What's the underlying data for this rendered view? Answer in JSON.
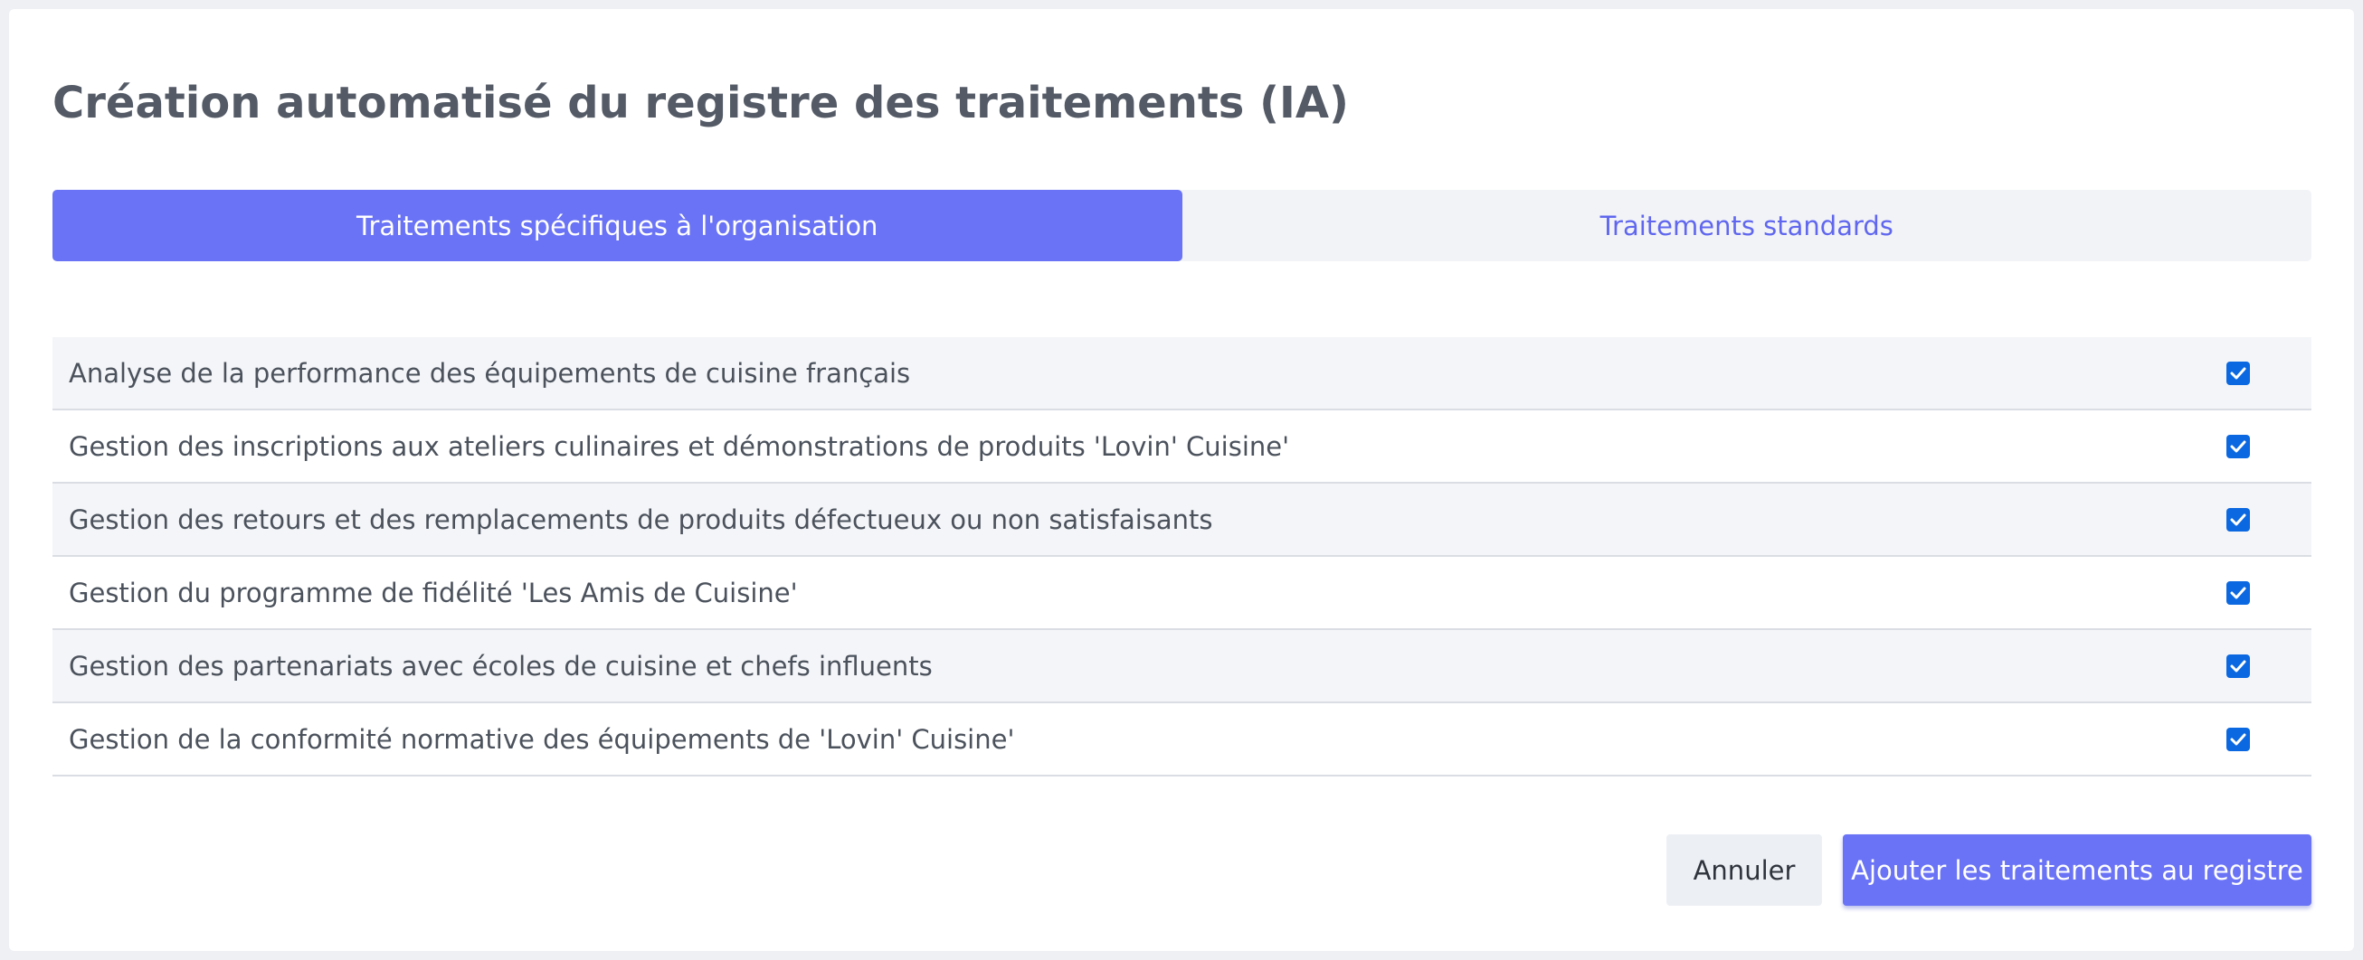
{
  "modal": {
    "title": "Création automatisé du registre des traitements (IA)"
  },
  "tabs": [
    {
      "label": "Traitements spécifiques à l'organisation",
      "active": true
    },
    {
      "label": "Traitements standards",
      "active": false
    }
  ],
  "treatments": [
    {
      "label": "Analyse de la performance des équipements de cuisine français",
      "checked": true
    },
    {
      "label": "Gestion des inscriptions aux ateliers culinaires et démonstrations de produits 'Lovin' Cuisine'",
      "checked": true
    },
    {
      "label": "Gestion des retours et des remplacements de produits défectueux ou non satisfaisants",
      "checked": true
    },
    {
      "label": "Gestion du programme de fidélité 'Les Amis de Cuisine'",
      "checked": true
    },
    {
      "label": "Gestion des partenariats avec écoles de cuisine et chefs influents",
      "checked": true
    },
    {
      "label": "Gestion de la conformité normative des équipements de 'Lovin' Cuisine'",
      "checked": true
    }
  ],
  "actions": {
    "cancel_label": "Annuler",
    "submit_label": "Ajouter les traitements au registre"
  },
  "colors": {
    "accent": "#6a73f5",
    "checkbox": "#0b68e0",
    "title": "#545b66"
  },
  "icons": {
    "checkbox": "checkmark-icon"
  }
}
